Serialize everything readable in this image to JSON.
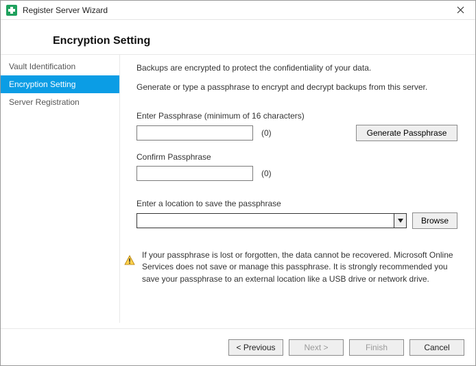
{
  "window": {
    "title": "Register Server Wizard"
  },
  "header": {
    "title": "Encryption Setting"
  },
  "sidebar": {
    "items": [
      {
        "label": "Vault Identification",
        "active": false
      },
      {
        "label": "Encryption Setting",
        "active": true
      },
      {
        "label": "Server Registration",
        "active": false
      }
    ]
  },
  "main": {
    "intro1": "Backups are encrypted to protect the confidentiality of your data.",
    "intro2": "Generate or type a passphrase to encrypt and decrypt backups from this server.",
    "enter_label": "Enter Passphrase (minimum of 16 characters)",
    "enter_value": "",
    "enter_count": "(0)",
    "generate_button": "Generate Passphrase",
    "confirm_label": "Confirm Passphrase",
    "confirm_value": "",
    "confirm_count": "(0)",
    "location_label": "Enter a location to save the passphrase",
    "location_value": "",
    "browse_button": "Browse",
    "warning_text": "If your passphrase is lost or forgotten, the data cannot be recovered. Microsoft Online Services does not save or manage this passphrase. It is strongly recommended you save your passphrase to an external location like a USB drive or network drive."
  },
  "footer": {
    "previous": "< Previous",
    "next": "Next >",
    "finish": "Finish",
    "cancel": "Cancel"
  }
}
